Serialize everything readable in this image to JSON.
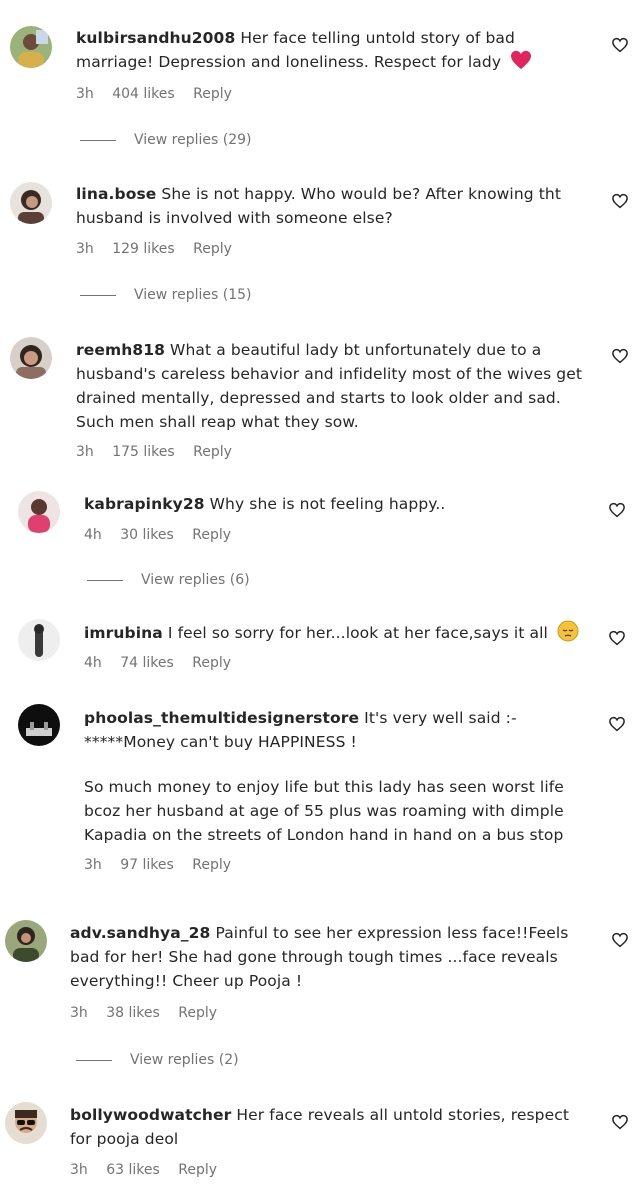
{
  "comments": [
    {
      "username": "kulbirsandhu2008",
      "text": "Her face telling untold story of bad marriage! Depression and loneliness. Respect for lady",
      "time": "3h",
      "likes": "404 likes",
      "reply": "Reply",
      "view_replies": "View replies (29)",
      "emoji": "red-heart"
    },
    {
      "username": "lina.bose",
      "text": "She is not happy. Who would be? After knowing tht husband is involved with someone else?",
      "time": "3h",
      "likes": "129 likes",
      "reply": "Reply",
      "view_replies": "View replies (15)"
    },
    {
      "username": "reemh818",
      "text": "What a beautiful lady bt unfortunately due to a husband's careless behavior and infidelity most of the wives get drained mentally, depressed and starts to look older and sad. Such men shall reap what they sow.",
      "time": "3h",
      "likes": "175 likes",
      "reply": "Reply"
    },
    {
      "username": "kabrapinky28",
      "text": "Why she is not feeling happy..",
      "time": "4h",
      "likes": "30 likes",
      "reply": "Reply",
      "view_replies": "View replies (6)"
    },
    {
      "username": "imrubina",
      "text": "I feel so sorry for her...look at her face,says it all",
      "time": "4h",
      "likes": "74 likes",
      "reply": "Reply",
      "emoji": "pensive-face"
    },
    {
      "username": "phoolas_themultidesignerstore",
      "text": "It's very well said :-*****Money can't buy HAPPINESS !",
      "text2": "So much money to enjoy life but this lady has seen worst life bcoz her husband at age of 55 plus was roaming with dimple Kapadia on the streets of London hand in hand on a bus stop",
      "time": "3h",
      "likes": "97 likes",
      "reply": "Reply"
    },
    {
      "username": "adv.sandhya_28",
      "text": "Painful to see her expression less face!!Feels bad for her! She had gone through tough times ...face reveals everything!! Cheer up Pooja !",
      "time": "3h",
      "likes": "38 likes",
      "reply": "Reply",
      "view_replies": "View replies (2)"
    },
    {
      "username": "bollywoodwatcher",
      "text": "Her face reveals all untold stories, respect for pooja deol",
      "time": "3h",
      "likes": "63 likes",
      "reply": "Reply"
    }
  ],
  "colors": {
    "text": "#262626",
    "secondary": "#737373",
    "heart_emoji": "#e0245e"
  },
  "icons": {
    "like": "heart-outline-icon"
  }
}
